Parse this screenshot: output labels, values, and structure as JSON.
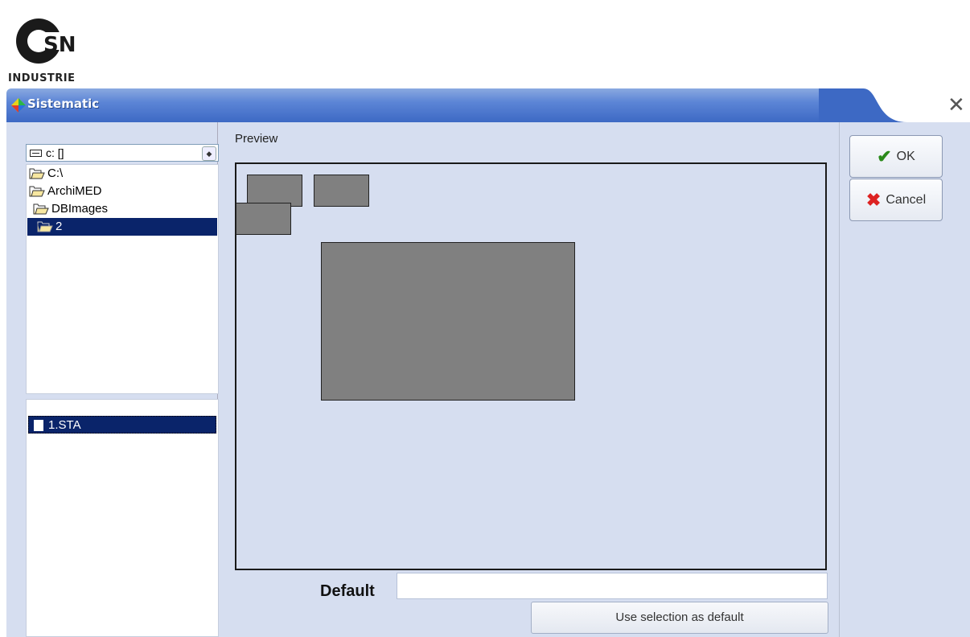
{
  "logo": {
    "mark": "CSN",
    "text": "INDUSTRIE"
  },
  "window": {
    "title": "Sistematic",
    "close_icon": "close-icon"
  },
  "drive": {
    "label": "c: []",
    "icon": "drive-icon"
  },
  "tree": {
    "items": [
      {
        "label": "C:\\",
        "icon": "open-folder-icon",
        "selected": false
      },
      {
        "label": "ArchiMED",
        "icon": "open-folder-icon",
        "selected": false
      },
      {
        "label": "DBImages",
        "icon": "open-folder-icon",
        "selected": false
      },
      {
        "label": "2",
        "icon": "open-folder-icon",
        "selected": true
      }
    ]
  },
  "files": {
    "items": [
      {
        "label": "1.STA",
        "icon": "file-icon",
        "selected": true
      }
    ]
  },
  "preview": {
    "label": "Preview"
  },
  "default": {
    "label": "Default",
    "value": ""
  },
  "buttons": {
    "use_default": "Use selection as default",
    "ok": "OK",
    "cancel": "Cancel"
  },
  "colors": {
    "title_bar": "#3d69c4",
    "selection": "#0a246a",
    "client": "#d6def0",
    "preview_box": "#808080"
  }
}
